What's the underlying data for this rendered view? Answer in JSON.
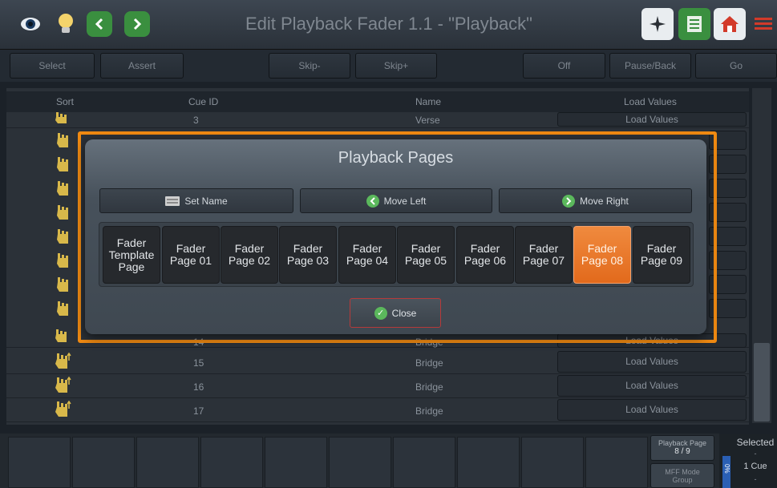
{
  "title": "Edit Playback Fader 1.1 - \"Playback\"",
  "toolbar": {
    "select": "Select",
    "assert": "Assert",
    "skip_minus": "Skip-",
    "skip_plus": "Skip+",
    "off": "Off",
    "pause_back": "Pause/Back",
    "go": "Go"
  },
  "table": {
    "headers": {
      "sort": "Sort",
      "cue_id": "Cue ID",
      "name": "Name",
      "load_values": "Load Values"
    },
    "rows": [
      {
        "cue": "3",
        "name": "Verse",
        "load": "Load Values"
      },
      {
        "cue": "14",
        "name": "Bridge",
        "load": "Load Values"
      },
      {
        "cue": "15",
        "name": "Bridge",
        "load": "Load Values"
      },
      {
        "cue": "16",
        "name": "Bridge",
        "load": "Load Values"
      },
      {
        "cue": "17",
        "name": "Bridge",
        "load": "Load Values"
      }
    ]
  },
  "dialog": {
    "title": "Playback Pages",
    "set_name": "Set Name",
    "move_left": "Move Left",
    "move_right": "Move Right",
    "pages": [
      "Fader Template Page",
      "Fader Page 01",
      "Fader Page 02",
      "Fader Page 03",
      "Fader Page 04",
      "Fader Page 05",
      "Fader Page 06",
      "Fader Page 07",
      "Fader Page 08",
      "Fader Page 09"
    ],
    "active_page_index": 8,
    "close": "Close"
  },
  "bottom": {
    "playback_page_label": "Playback Page",
    "playback_page_value": "8 / 9",
    "mff_mode_label": "MFF Mode",
    "mff_mode_value": "Group",
    "selected_label": "Selected",
    "selected_dash": "-",
    "selected_value": "1 Cue",
    "selected_dash2": "-",
    "side_percent": "0%"
  },
  "colors": {
    "accent": "#f08a12",
    "active_page": "#e8762c",
    "close_border": "#b63a3a"
  }
}
